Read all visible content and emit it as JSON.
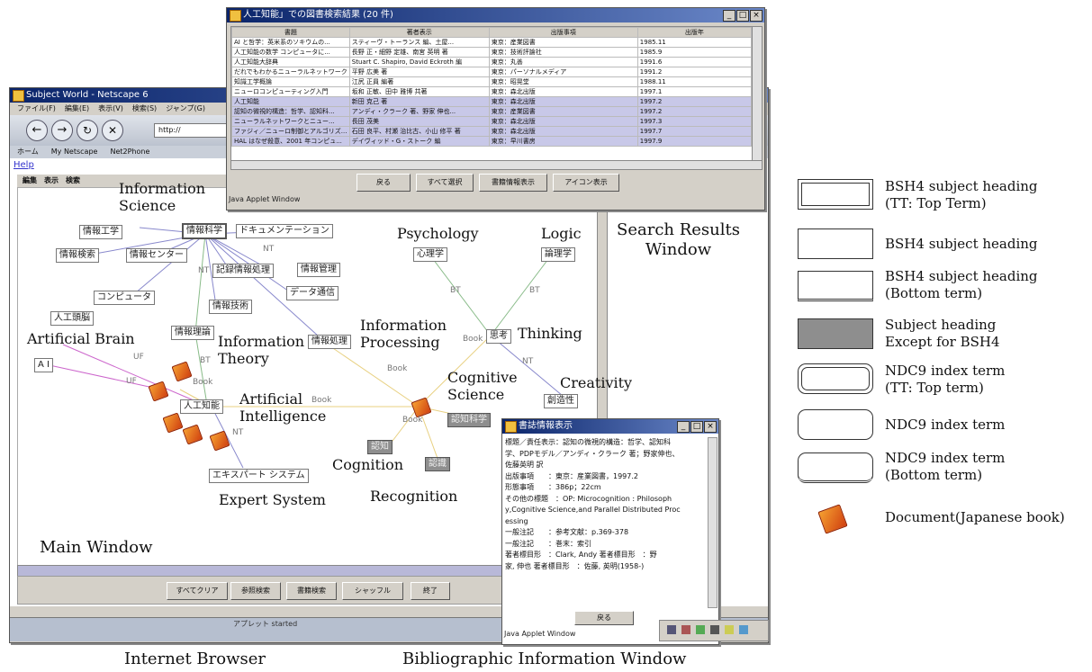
{
  "main_window": {
    "browser_title": "Subject World - Netscape 6",
    "menu_items": [
      "ファイル(F)",
      "編集(E)",
      "表示(V)",
      "検索(S)",
      "ジャンプ(G)"
    ],
    "bookmarks": [
      "ホーム",
      "My Netscape",
      "Net2Phone"
    ],
    "url_prefix": "http://",
    "help_link": "Help",
    "applet_menu": [
      "編集",
      "表示",
      "検索"
    ],
    "status_text": "アプレット started",
    "buttons": [
      "すべてクリア",
      "参照検索",
      "書籍検索",
      "シャッフル",
      "終了"
    ]
  },
  "graph_nodes_jp": {
    "info_science": "情報科学",
    "info_engineering": "情報工学",
    "documentation": "ドキュメンテーション",
    "info_retrieval": "情報検索",
    "info_center": "情報センター",
    "info_management": "情報管理",
    "records_info": "記録情報処理",
    "data_comm": "データ通信",
    "computer": "コンピュータ",
    "info_tech": "情報技術",
    "ai_brain": "人工頭脳",
    "info_theory": "情報理論",
    "info_processing": "情報処理",
    "ai_ascii": "A I",
    "ai": "人工知能",
    "expert_system": "エキスパート システム",
    "psychology": "心理学",
    "logic": "論理学",
    "thinking": "思考",
    "creativity": "創造性",
    "cognitive_science": "認知科学",
    "cognition": "認知",
    "recognition": "認識"
  },
  "edge_labels": {
    "bt": "BT",
    "nt": "NT",
    "uf": "UF",
    "book": "Book"
  },
  "annotations": {
    "information_science": "Information\nScience",
    "psychology": "Psychology",
    "logic": "Logic",
    "search_results_window": "Search Results\nWindow",
    "information_processing": "Information\nProcessing",
    "thinking": "Thinking",
    "artificial_brain": "Artificial Brain",
    "information_theory": "Information\nTheory",
    "cognitive_science": "Cognitive\nScience",
    "creativity": "Creativity",
    "artificial_intelligence": "Artificial\nIntelligence",
    "cognition": "Cognition",
    "recognition": "Recognition",
    "expert_system": "Expert System",
    "main_window": "Main Window",
    "internet_browser": "Internet Browser",
    "bibliographic_information_window": "Bibliographic Information Window"
  },
  "search_results": {
    "title": "人工知能」での図書検索結果 (20 件)",
    "columns": [
      "書題",
      "著者表示",
      "出版事項",
      "出版年"
    ],
    "rows": [
      {
        "title": "AI と哲学：英米系のソキウムの...",
        "author": "スティーヴ・トーランス 編、土屋...",
        "publisher": "東京：産業図書",
        "year": "1985.11",
        "selected": false
      },
      {
        "title": "人工知能の数学 コンピュータに...",
        "author": "長野 正・細野 定雄、南宮 英明 著",
        "publisher": "東京：技術評論社",
        "year": "1985.9",
        "selected": false
      },
      {
        "title": "人工知能大辞典",
        "author": "Stuart C. Shapiro, David Eckroth 編",
        "publisher": "東京：丸善",
        "year": "1991.6",
        "selected": false
      },
      {
        "title": "だれでもわかるニューラルネットワーク",
        "author": "平野 広美 著",
        "publisher": "東京：パーソナルメディア",
        "year": "1991.2",
        "selected": false
      },
      {
        "title": "知識工学概論",
        "author": "江尻 正員 編著",
        "publisher": "東京：昭晃堂",
        "year": "1988.11",
        "selected": false
      },
      {
        "title": "ニューロコンピューティング入門",
        "author": "坂和 正敏、田中 雅博 共著",
        "publisher": "東京：森北出版",
        "year": "1997.1",
        "selected": false
      },
      {
        "title": "人工知能",
        "author": "新田 克己 著",
        "publisher": "東京：森北出版",
        "year": "1997.2",
        "selected": true
      },
      {
        "title": "認知の微視的構造：哲学、認知科...",
        "author": "アンディ・クラーク 著、野家 伸也...",
        "publisher": "東京：産業図書",
        "year": "1997.2",
        "selected": true
      },
      {
        "title": "ニューラルネットワークとニュー...",
        "author": "長田 茂美",
        "publisher": "東京：森北出版",
        "year": "1997.3",
        "selected": true
      },
      {
        "title": "ファジィ／ニューロ制御とアルゴリズ...",
        "author": "石田 良平、村瀬 治比古、小山 修平 著",
        "publisher": "東京：森北出版",
        "year": "1997.7",
        "selected": true
      },
      {
        "title": "HAL はなぜ殺意、2001 年コンピュ...",
        "author": "デイヴィッド・G・ストーク 編",
        "publisher": "東京：早川書房",
        "year": "1997.9",
        "selected": true
      }
    ],
    "buttons": [
      "戻る",
      "すべて選択",
      "書籍情報表示",
      "アイコン表示"
    ],
    "status": "Java Applet Window"
  },
  "bibliographic": {
    "title": "書誌情報表示",
    "lines": [
      "標題／責任表示：認知の微視的構造：哲学、認知科",
      "学、PDPモデル／アンディ・クラーク 著；野家伸也、",
      "佐藤英明 訳",
      "出版事項　　：東京：産業図書，1997.2",
      "形態事項　　：386p；22cm",
      "その他の標題　：OP: Microcognition : Philosoph",
      "y,Cognitive Science,and Parallel Distributed Proc",
      "essing",
      "一般注記　　：参考文献：p.369-378",
      "一般注記　　：巻末：索引",
      "著者標目形　：Clark, Andy 著者標目形　：野",
      "家, 伸也 著者標目形　：佐藤, 英明(1958-)"
    ],
    "button": "戻る",
    "status": "Java Applet Window"
  },
  "legend": [
    {
      "label": "BSH4 subject heading\n(TT: Top Term)",
      "kind": "bsh-tt"
    },
    {
      "label": "BSH4 subject heading",
      "kind": "bsh"
    },
    {
      "label": "BSH4 subject heading\n(Bottom term)",
      "kind": "bsh-bt"
    },
    {
      "label": "Subject heading\nExcept for BSH4",
      "kind": "gray"
    },
    {
      "label": "NDC9 index term\n(TT: Top term)",
      "kind": "ndc-tt"
    },
    {
      "label": "NDC9 index term",
      "kind": "ndc"
    },
    {
      "label": "NDC9 index term\n(Bottom term)",
      "kind": "ndc-bt"
    },
    {
      "label": "Document(Japanese book)",
      "kind": "book"
    }
  ],
  "colors": {
    "titlebar": "#0a246a",
    "selection": "#c8c8e8",
    "gray_node": "#8e8e8e",
    "book_orange": "#e06020",
    "edge_bt": "#88bb88",
    "edge_nt": "#8888cc",
    "edge_uf": "#cc66cc",
    "edge_book": "#e8d080"
  }
}
